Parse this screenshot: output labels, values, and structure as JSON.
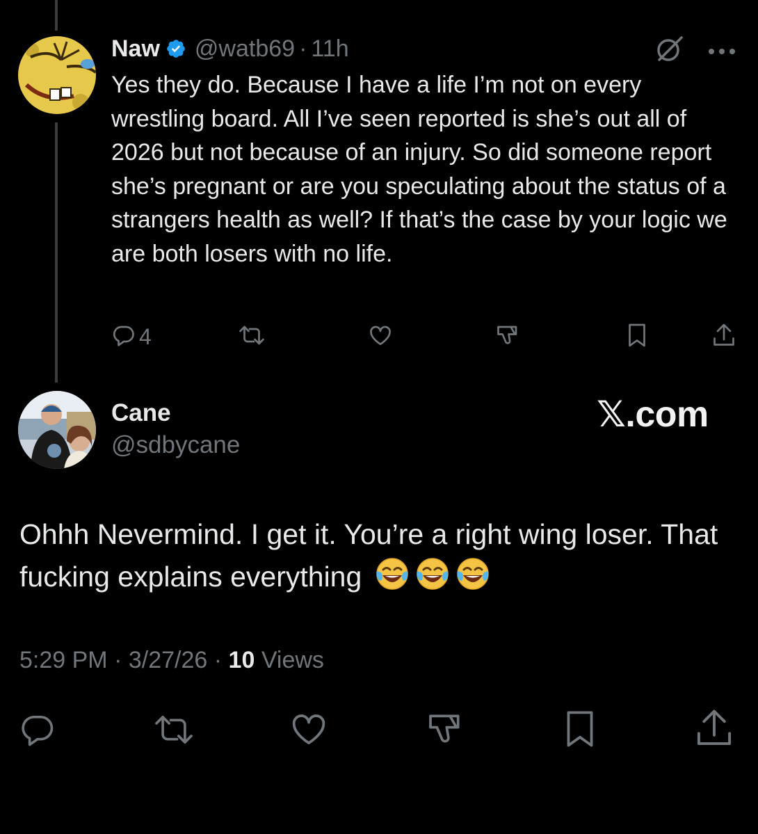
{
  "reply": {
    "name": "Naw",
    "handle": "@watb69",
    "separator": "·",
    "time": "11h",
    "text": "Yes they do. Because I have a life I’m not on every wrestling board. All I’ve seen reported is she’s out all of 2026 but not because of an injury. So did someone report she’s pregnant or are you speculating about the status of a strangers health as well? If that’s the case by your logic we are both losers with no life.",
    "reply_count": "4",
    "icons": [
      "verified-badge-icon",
      "grok-icon",
      "more-icon",
      "reply-icon",
      "repost-icon",
      "like-icon",
      "dislike-icon",
      "bookmark-icon",
      "share-icon"
    ]
  },
  "main": {
    "name": "Cane",
    "handle": "@sdbycane",
    "text": "Ohhh Nevermind. I get it. You’re a right wing loser. That fucking explains everything",
    "emoji": [
      "😂",
      "😂",
      "😂"
    ],
    "time": "5:29 PM",
    "date": "3/27/26",
    "separator": "·",
    "views_count": "10",
    "views_label": "Views"
  },
  "watermark": "𝕏.com",
  "colors": {
    "background": "#000000",
    "text": "#e7e9ea",
    "muted": "#71767b",
    "verified": "#1d9bf0",
    "thread_line": "#3a3d40"
  }
}
